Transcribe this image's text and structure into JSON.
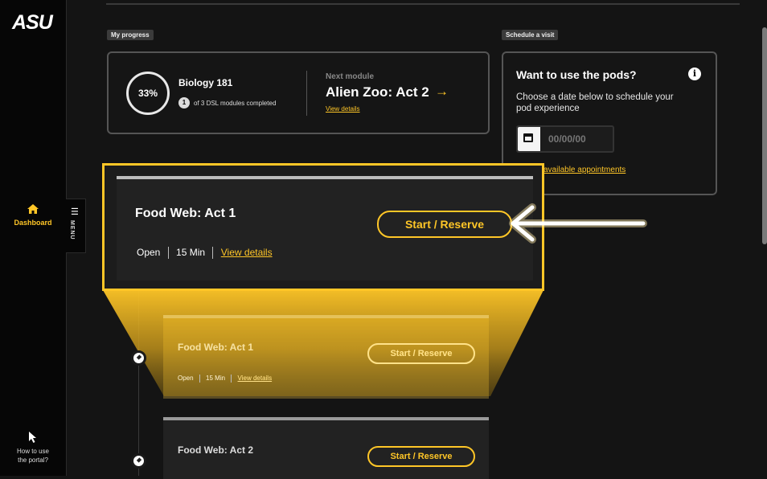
{
  "sidebar": {
    "logo": "ASU",
    "dashboard_label": "Dashboard",
    "menu_label": "MENU",
    "help_line1": "How to use",
    "help_line2": "the portal?"
  },
  "progress": {
    "tag": "My progress",
    "percent": "33%",
    "course": "Biology 181",
    "completed_count": "1",
    "completed_text": "of 3 DSL modules completed",
    "next_label": "Next module",
    "next_title": "Alien Zoo: Act 2",
    "next_link": "View details"
  },
  "schedule": {
    "tag": "Schedule a visit",
    "title": "Want to use the pods?",
    "description": "Choose a date below to schedule your pod experience",
    "date_placeholder": "00/00/00",
    "appointments_link": "available appointments"
  },
  "spotlight": {
    "title": "Food Web: Act 1",
    "button": "Start / Reserve",
    "status": "Open",
    "duration": "15 Min",
    "link": "View details"
  },
  "modules": [
    {
      "title": "Food Web: Act 1",
      "button": "Start / Reserve",
      "status": "Open",
      "duration": "15 Min",
      "link": "View details"
    },
    {
      "title": "Food Web: Act 2",
      "button": "Start / Reserve"
    }
  ],
  "colors": {
    "accent": "#FFC627",
    "background": "#141414",
    "card": "#222222"
  },
  "icons": [
    "home-icon",
    "hamburger-icon",
    "cursor-icon",
    "info-icon",
    "calendar-icon",
    "arrow-right-icon",
    "pointer-arrow-icon",
    "checkpoint-icon"
  ]
}
